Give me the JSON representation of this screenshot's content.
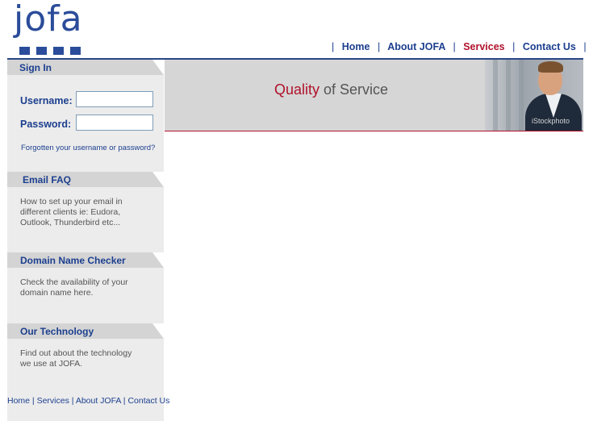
{
  "logo": {
    "text": "jofa"
  },
  "nav": {
    "items": [
      {
        "label": "Home",
        "active": false
      },
      {
        "label": "About JOFA",
        "active": false
      },
      {
        "label": "Services",
        "active": true
      },
      {
        "label": "Contact Us",
        "active": false
      }
    ],
    "separator": "|"
  },
  "banner": {
    "tagline_highlight": "Quality",
    "tagline_rest": " of Service",
    "photo_watermark": "iStockphoto"
  },
  "sidebar": {
    "signin": {
      "title": "Sign In",
      "username_label": "Username:",
      "username_value": "",
      "password_label": "Password:",
      "password_value": "",
      "forgot_link": "Forgotten your username or password?"
    },
    "email_faq": {
      "title": "Email FAQ",
      "line1": "How to set up your email in",
      "line2": "different clients ie: Eudora,",
      "line3": "Outlook, Thunderbird etc..."
    },
    "domain_checker": {
      "title": "Domain Name Checker",
      "line1": "Check the availability of your",
      "line2": "domain name here."
    },
    "technology": {
      "title": "Our Technology",
      "line1": "Find out about the technology",
      "line2": "we use at JOFA."
    }
  },
  "footer_nav": {
    "items": [
      "Home",
      "Services",
      "About JOFA",
      "Contact Us"
    ],
    "separator": " | "
  },
  "colors": {
    "brand_blue": "#1c3f8f",
    "accent_red": "#b0122b",
    "sidebar_bg": "#ececec",
    "banner_bg": "#d6d6d6"
  }
}
